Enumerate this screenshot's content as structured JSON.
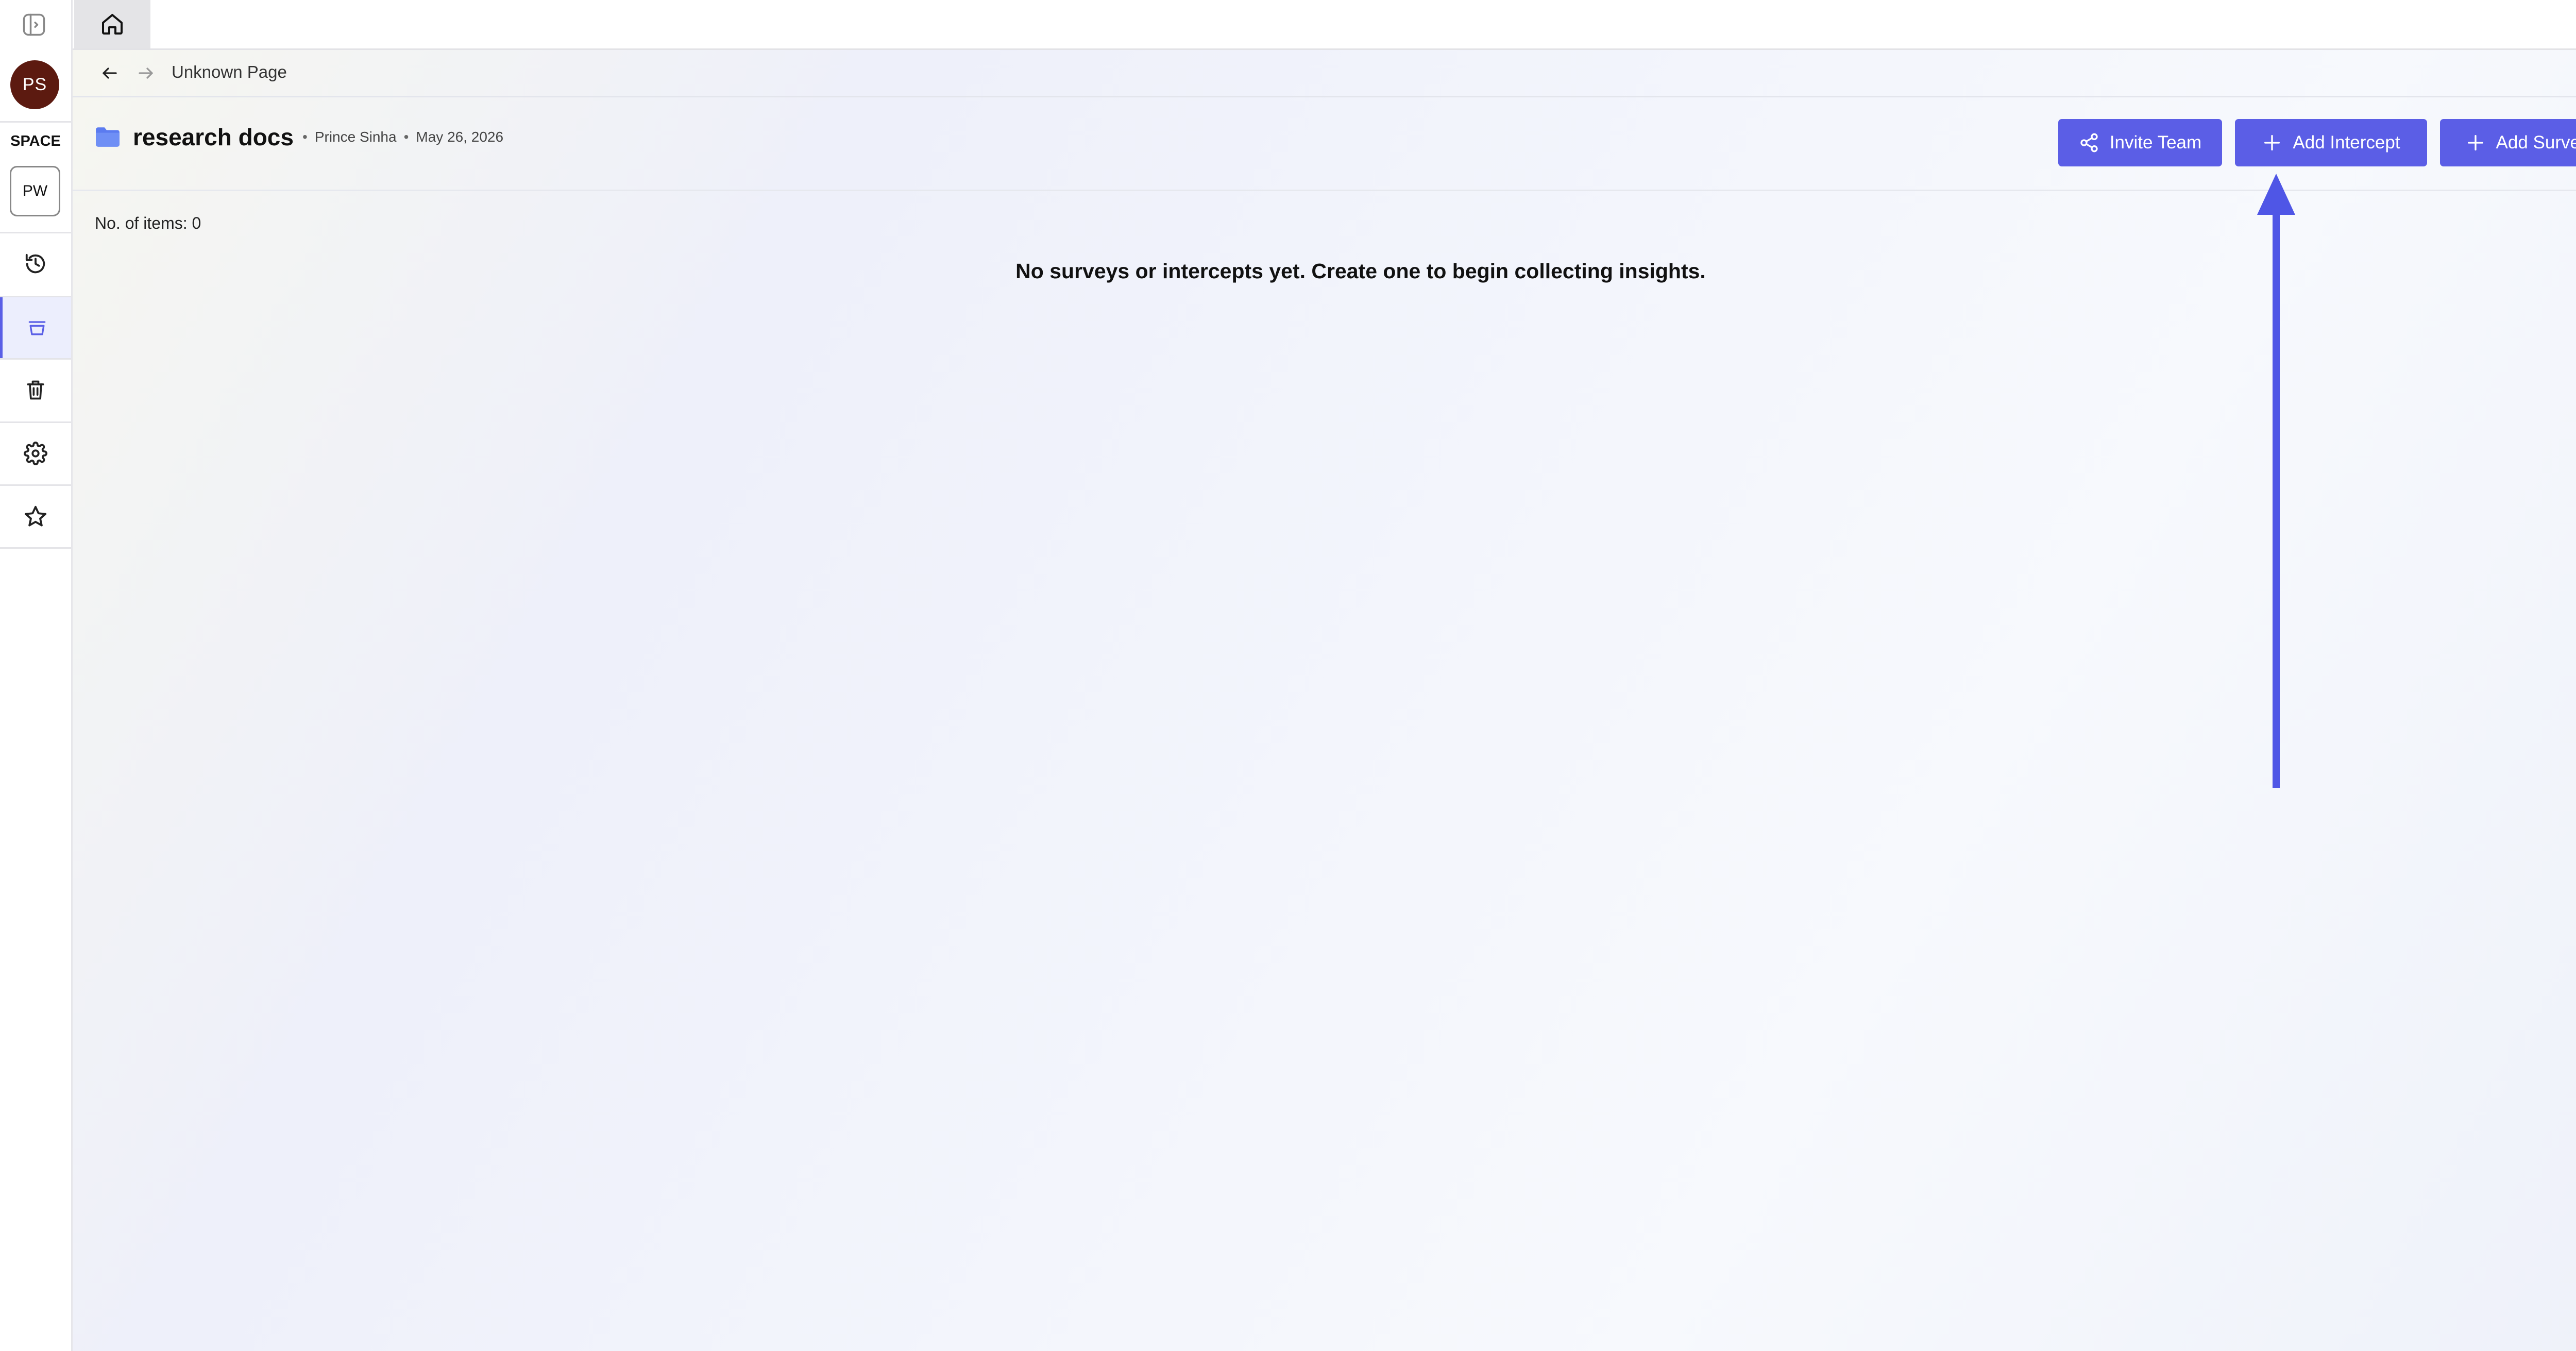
{
  "sidebar": {
    "avatar_initials": "PS",
    "space_label": "SPACE",
    "space_badge": "PW",
    "nav_icons": [
      "history-icon",
      "inbox-icon",
      "trash-icon",
      "gear-icon",
      "star-icon"
    ],
    "active_item": "inbox-icon"
  },
  "topbar": {
    "home_icon": "home-icon"
  },
  "breadcrumb": {
    "page_name": "Unknown Page"
  },
  "header": {
    "title": "research docs",
    "owner": "Prince Sinha",
    "date": "May 26, 2026",
    "invite_label": "Invite Team",
    "add_intercept_label": "Add Intercept",
    "add_survey_label": "Add Survey"
  },
  "content": {
    "item_count": "No. of items: 0",
    "empty_message": "No surveys or intercepts yet. Create one to begin collecting insights."
  },
  "colors": {
    "accent": "#5b5ee6",
    "avatar_bg": "#5c1a10",
    "folder": "#5b7bf0"
  }
}
